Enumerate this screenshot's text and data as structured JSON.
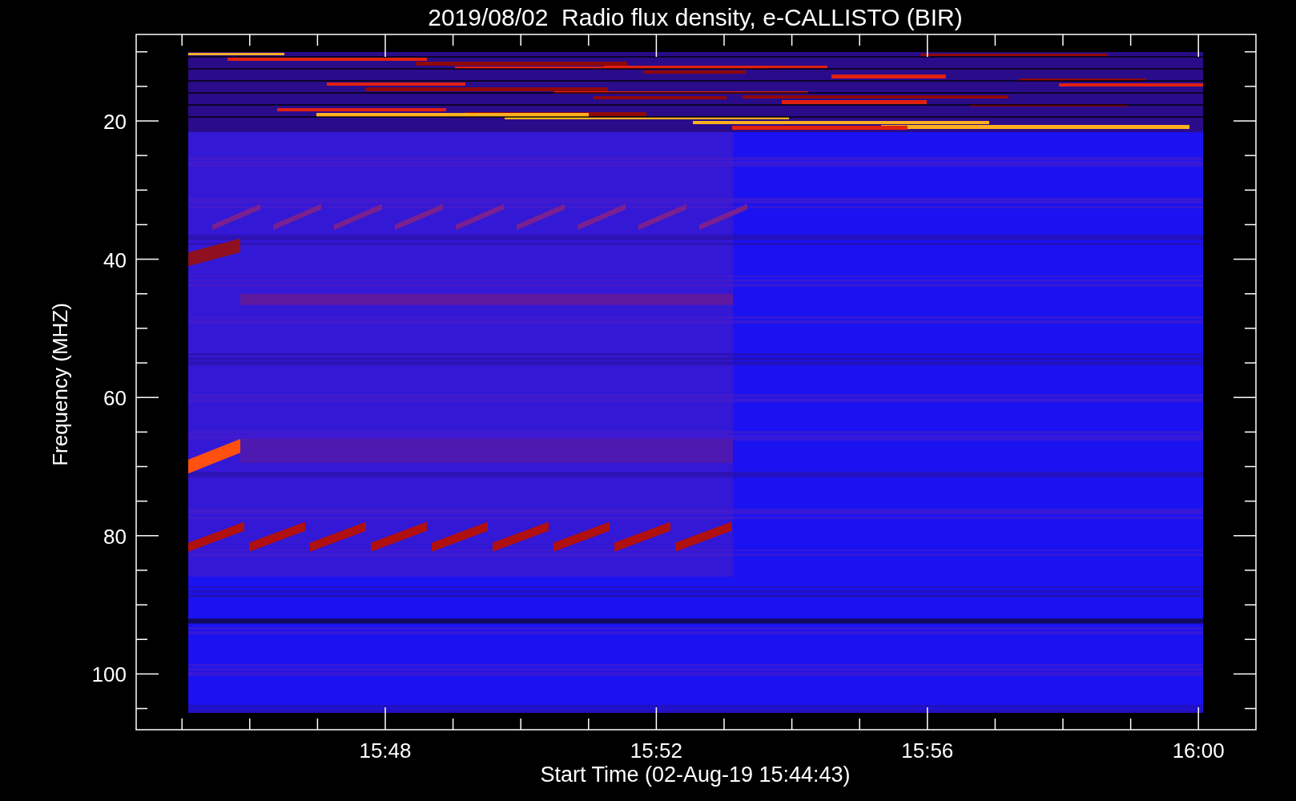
{
  "title": "2019/08/02  Radio flux density, e-CALLISTO (BIR)",
  "y_axis": {
    "label": "Frequency (MHZ)",
    "ticks": [
      "20",
      "40",
      "60",
      "80",
      "100"
    ]
  },
  "x_axis": {
    "label": "Start Time (02-Aug-19 15:44:43)",
    "ticks": [
      "15:48",
      "15:52",
      "15:56",
      "16:00"
    ]
  }
}
